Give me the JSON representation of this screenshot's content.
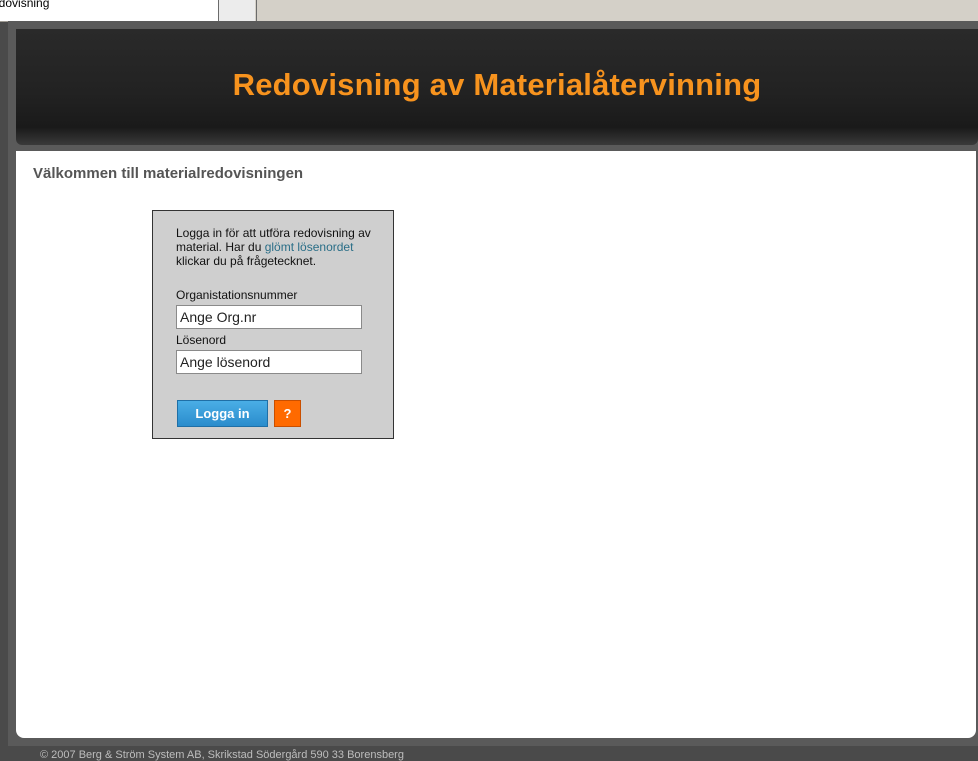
{
  "browser": {
    "tab_title": "edovisning"
  },
  "header": {
    "title": "Redovisning av Materialåtervinning"
  },
  "main": {
    "welcome": "Välkommen till materialredovisningen"
  },
  "login": {
    "intro_before": "Logga in för att utföra redovisning av material. Har du ",
    "forgot_link": "glömt lösenordet",
    "intro_after": " klickar du på frågetecknet.",
    "org_label": "Organistationsnummer",
    "org_value": "Ange Org.nr",
    "password_label": "Lösenord",
    "password_value": "Ange lösenord",
    "submit_label": "Logga in",
    "help_label": "?"
  },
  "footer": {
    "text": "© 2007 Berg & Ström System AB, Skrikstad Södergård 590 33 Borensberg"
  },
  "colors": {
    "accent_title": "#f7931e",
    "button_blue": "#2a8ccc",
    "button_orange": "#ff6a00",
    "link": "#2a6e87"
  }
}
